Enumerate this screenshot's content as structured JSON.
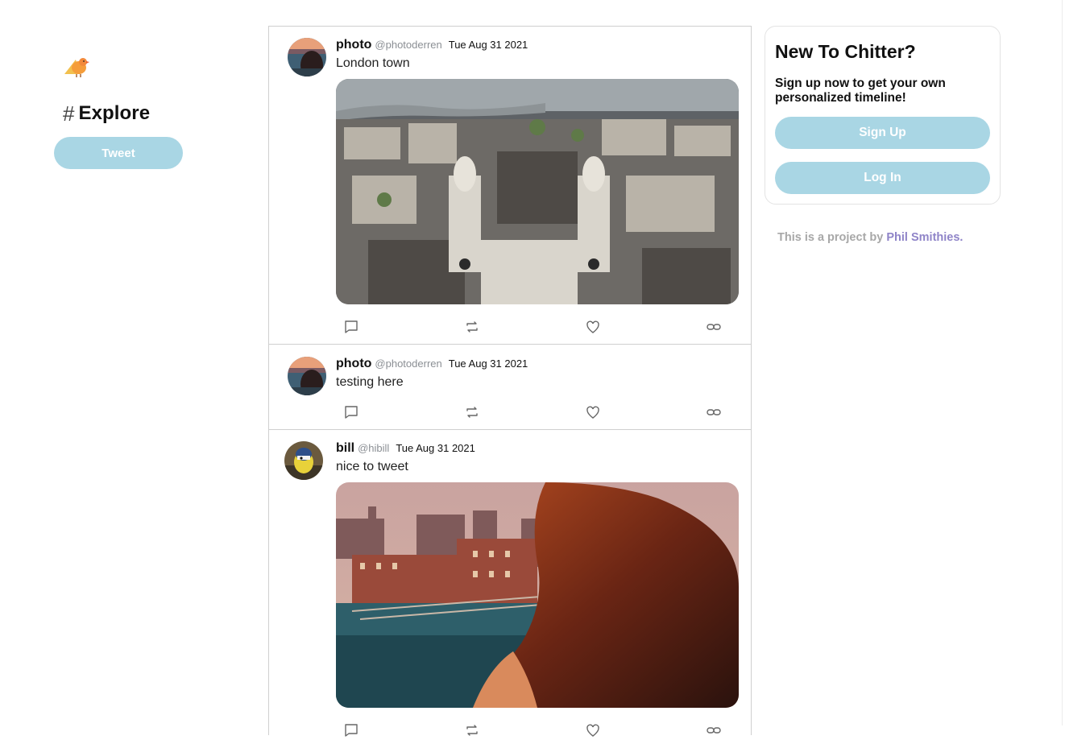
{
  "app": {
    "brand_colors": {
      "accent": "#a9d6e4",
      "link": "#8f84c8",
      "muted": "#a8a8a8"
    }
  },
  "sidebar": {
    "logo_icon": "bird-logo-icon",
    "nav": {
      "icon": "#",
      "label": "Explore"
    },
    "tweet_button": "Tweet"
  },
  "posts": [
    {
      "name": "photo",
      "handle": "@photoderren",
      "date": "Tue Aug 31 2021",
      "text": "London town",
      "avatar_icon": "user-avatar-photo",
      "has_media": true,
      "media_icon": "london-aerial-photo"
    },
    {
      "name": "photo",
      "handle": "@photoderren",
      "date": "Tue Aug 31 2021",
      "text": "testing here",
      "avatar_icon": "user-avatar-photo",
      "has_media": false
    },
    {
      "name": "bill",
      "handle": "@hibill",
      "date": "Tue Aug 31 2021",
      "text": "nice to tweet",
      "avatar_icon": "user-avatar-bird",
      "has_media": true,
      "media_icon": "city-skyline-photo"
    }
  ],
  "actions": [
    "reply-icon",
    "retweet-icon",
    "like-icon",
    "link-icon"
  ],
  "signup": {
    "title": "New To Chitter?",
    "subtitle": "Sign up now to get your own personalized timeline!",
    "signup_button": "Sign Up",
    "login_button": "Log In"
  },
  "footer": {
    "prefix": "This is a project by",
    "author": "Phil Smithies."
  }
}
